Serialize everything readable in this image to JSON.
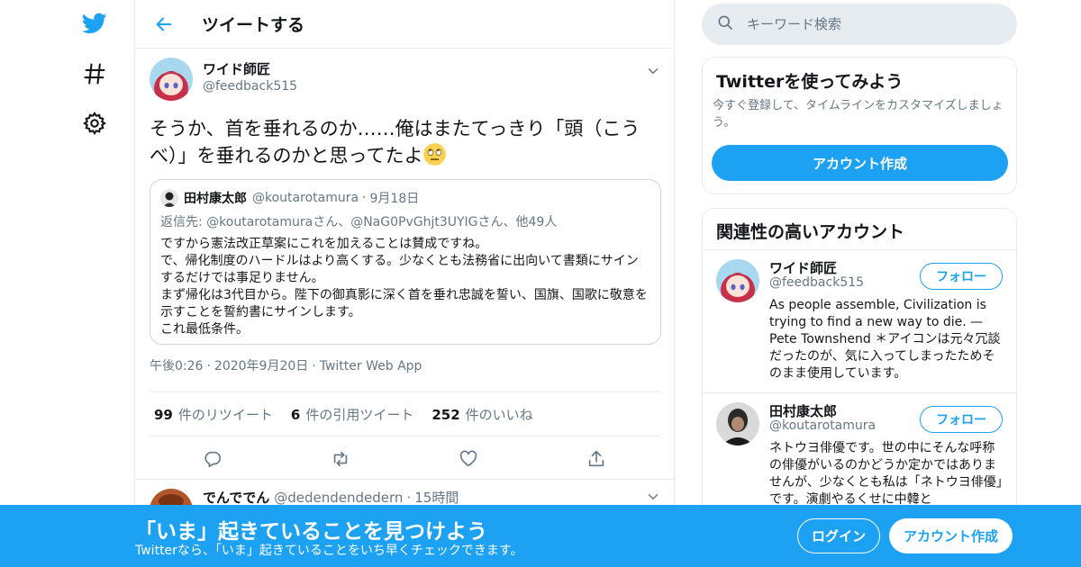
{
  "colors": {
    "accent": "#1da1f2",
    "text": "#14171a",
    "secondary": "#657786",
    "border": "#e6ecf0"
  },
  "nav": {
    "icons": [
      "twitter-bird-icon",
      "hashtag-icon",
      "gear-icon"
    ]
  },
  "header": {
    "title": "ツイートする"
  },
  "tweet": {
    "author_name": "ワイド師匠",
    "author_handle": "@feedback515",
    "text": "そうか、首を垂れるのか……俺はまたてっきり「頭（こうべ）」を垂れるのかと思ってたよ",
    "time": "午後0:26",
    "date": "2020年9月20日",
    "source": "Twitter Web App",
    "sep": "·",
    "retweets_count": "99",
    "retweets_label": "件のリツイート",
    "quotes_count": "6",
    "quotes_label": "件の引用ツイート",
    "likes_count": "252",
    "likes_label": "件のいいね"
  },
  "quote": {
    "name": "田村康太郎",
    "handle": "@koutarotamura",
    "sep": "·",
    "date": "9月18日",
    "reply_to": "返信先: @koutarotamuraさん、@NaG0PvGhjt3UYIGさん、他49人",
    "lines": [
      "ですから憲法改正草案にこれを加えることは賛成ですね。",
      "で、帰化制度のハードルはより高くする。少なくとも法務省に出向いて書類にサインするだけでは事足りません。",
      "まず帰化は3代目から。陛下の御真影に深く首を垂れ忠誠を誓い、国旗、国歌に敬意を示すことを誓約書にサインします。",
      "これ最低条件。"
    ]
  },
  "next_tweet": {
    "name": "でんででん",
    "handle": "@dedendendedern",
    "sep": "·",
    "time": "15時間"
  },
  "search": {
    "placeholder": "キーワード検索"
  },
  "signup_card": {
    "title": "Twitterを使ってみよう",
    "description": "今すぐ登録して、タイムラインをカスタマイズしましょう。",
    "button": "アカウント作成"
  },
  "related": {
    "title": "関連性の高いアカウント",
    "accounts": [
      {
        "name": "ワイド師匠",
        "handle": "@feedback515",
        "follow": "フォロー",
        "bio": "As people assemble, Civilization is trying to find a new way to die. — Pete Townshend ＊アイコンは元々冗談だったのが、気に入ってしまったためそのまま使用しています。"
      },
      {
        "name": "田村康太郎",
        "handle": "@koutarotamura",
        "follow": "フォロー",
        "bio": "ネトウヨ俳優です。世の中にそんな呼称の俳優がいるのかどうか定かではありませんが、少なくとも私は「ネトウヨ俳優」です。演劇やるくせに中韓と"
      }
    ]
  },
  "bottom_bar": {
    "title": "「いま」起きていることを見つけよう",
    "subtitle": "Twitterなら、「いま」起きていることをいち早くチェックできます。",
    "login": "ログイン",
    "signup": "アカウント作成"
  }
}
